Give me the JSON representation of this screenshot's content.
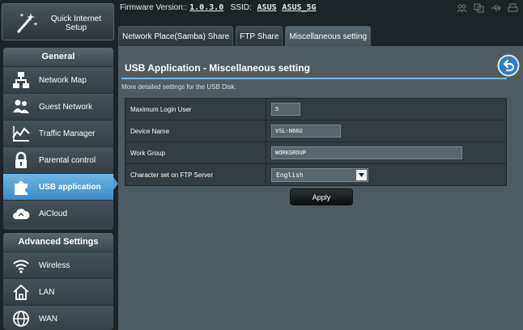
{
  "quick_setup": {
    "label_line1": "Quick Internet",
    "label_line2": "Setup"
  },
  "general": {
    "header": "General",
    "items": [
      {
        "label": "Network Map",
        "icon": "network-map-icon"
      },
      {
        "label": "Guest Network",
        "icon": "guest-network-icon"
      },
      {
        "label": "Traffic Manager",
        "icon": "traffic-manager-icon"
      },
      {
        "label": "Parental control",
        "icon": "lock-icon"
      },
      {
        "label": "USB application",
        "icon": "puzzle-icon",
        "active": true
      },
      {
        "label": "AiCloud",
        "icon": "cloud-icon"
      }
    ]
  },
  "advanced": {
    "header": "Advanced Settings",
    "items": [
      {
        "label": "Wireless",
        "icon": "wifi-icon"
      },
      {
        "label": "LAN",
        "icon": "home-icon"
      },
      {
        "label": "WAN",
        "icon": "globe-icon"
      }
    ]
  },
  "topbar": {
    "firmware_label": "Firmware Version::",
    "firmware_value": "1.0.3.0",
    "ssid_label": "SSID:",
    "ssid_1": "ASUS",
    "ssid_2": "ASUS_5G"
  },
  "tabs": [
    {
      "label": "Network Place(Samba) Share"
    },
    {
      "label": "FTP Share"
    },
    {
      "label": "Miscellaneous setting",
      "selected": true
    }
  ],
  "panel": {
    "title": "USB Application - Miscellaneous setting",
    "description": "More detailed settings for the USB Disk."
  },
  "settings": {
    "max_login_label": "Maximum Login User",
    "max_login_value": "5",
    "device_name_label": "Device Name",
    "device_name_value": "VSL-N66U",
    "work_group_label": "Work Group",
    "work_group_value": "WORKGROUP",
    "charset_label": "Character set on FTP Server",
    "charset_value": "English"
  },
  "apply_label": "Apply",
  "colors": {
    "accent": "#4d9bd2",
    "panel": "#4f5b62",
    "sidebar": "#3a464d"
  }
}
